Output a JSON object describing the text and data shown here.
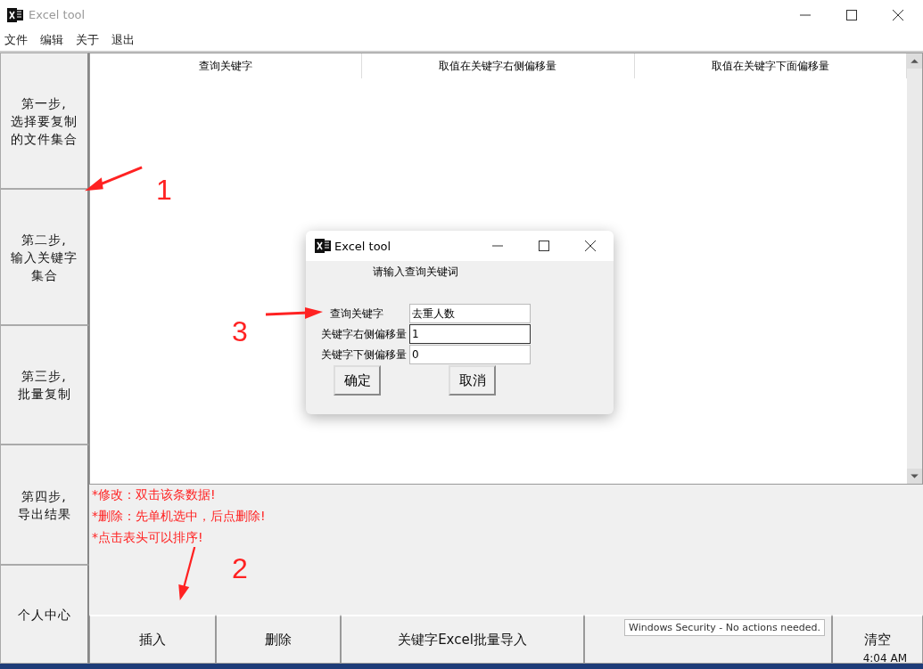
{
  "window": {
    "title": "Excel tool"
  },
  "menu": [
    "文件",
    "编辑",
    "关于",
    "退出"
  ],
  "steps": [
    [
      "第一步,",
      "选择要复制",
      "的文件集合"
    ],
    [
      "第二步,",
      "输入关键字",
      "集合"
    ],
    [
      "第三步,",
      "批量复制"
    ],
    [
      "第四步,",
      "导出结果"
    ],
    [
      "个人中心"
    ]
  ],
  "table": {
    "columns": [
      "查询关键字",
      "取值在关键字右侧偏移量",
      "取值在关键字下面偏移量"
    ]
  },
  "notes": [
    "*修改：双击该条数据!",
    "*删除：先单机选中，后点删除!",
    "*点击表头可以排序!"
  ],
  "buttons": [
    {
      "kind": "text",
      "label": "插入"
    },
    {
      "kind": "text",
      "label": "删除"
    },
    {
      "kind": "text",
      "label": "关键字Excel批量导入"
    },
    {
      "kind": "covered"
    },
    {
      "kind": "text",
      "label": "清空"
    }
  ],
  "dialog": {
    "title": "Excel tool",
    "heading": "请输入查询关键词",
    "fields": [
      {
        "label": "查询关键字",
        "value": "去重人数",
        "focused": false
      },
      {
        "label": "关键字右侧偏移量",
        "value": "1",
        "focused": true
      },
      {
        "label": "关键字下侧偏移量",
        "value": "0",
        "focused": false
      }
    ],
    "buttons": [
      "确定",
      "取消"
    ]
  },
  "annotations": [
    "1",
    "2",
    "3"
  ],
  "tooltip": "Windows Security - No actions needed.",
  "clock": "4:04 AM"
}
